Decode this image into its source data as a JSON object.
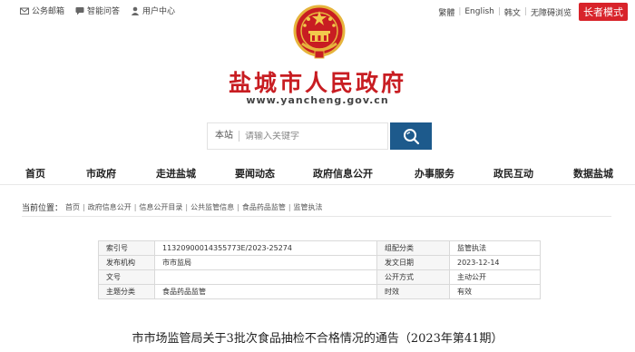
{
  "topbar": {
    "left": [
      {
        "label": "公务邮箱",
        "icon": "mail-icon"
      },
      {
        "label": "智能问答",
        "icon": "chat-icon"
      },
      {
        "label": "用户中心",
        "icon": "user-icon"
      }
    ],
    "right": [
      "繁體",
      "English",
      "韩文",
      "无障碍浏览"
    ],
    "elder_mode": "长者模式"
  },
  "header": {
    "title": "盐城市人民政府",
    "domain": "www.yancheng.gov.cn",
    "emblem": "national-emblem"
  },
  "search": {
    "scope": "本站",
    "placeholder": "请输入关键字",
    "button_icon": "search-icon"
  },
  "nav": [
    "首页",
    "市政府",
    "走进盐城",
    "要闻动态",
    "政府信息公开",
    "办事服务",
    "政民互动",
    "数据盐城"
  ],
  "breadcrumb": {
    "head": "当前位置：",
    "items": [
      "首页",
      "政府信息公开",
      "信息公开目录",
      "公共监管信息",
      "食品药品监管",
      "监管执法"
    ]
  },
  "info": {
    "rows": [
      {
        "k1": "索引号",
        "v1": "11320900014355773E/2023-25274",
        "k2": "组配分类",
        "v2": "监管执法"
      },
      {
        "k1": "发布机构",
        "v1": "市市监局",
        "k2": "发文日期",
        "v2": "2023-12-14"
      },
      {
        "k1": "文号",
        "v1": "",
        "k2": "公开方式",
        "v2": "主动公开"
      },
      {
        "k1": "主题分类",
        "v1": "食品药品监管",
        "k2": "时效",
        "v2": "有效"
      }
    ]
  },
  "article": {
    "title": "市市场监管局关于3批次食品抽检不合格情况的通告（2023年第41期）"
  },
  "colors": {
    "brand_red": "#c81d22",
    "search_blue": "#1d5a8c",
    "elder_red": "#d8232a"
  }
}
